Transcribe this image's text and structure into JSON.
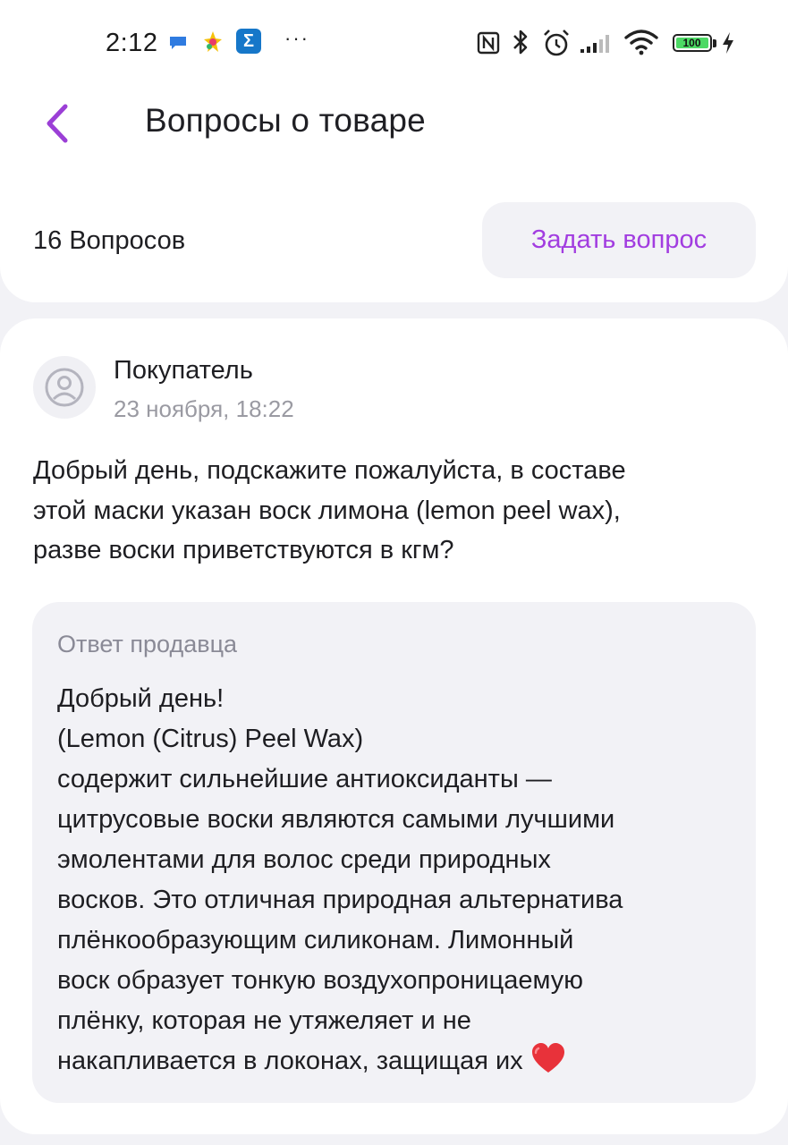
{
  "status_bar": {
    "time": "2:12",
    "more_dots": "···",
    "battery_level": "100",
    "sigma_glyph": "Σ"
  },
  "header": {
    "title": "Вопросы о товаре",
    "back_icon": "chevron-left-icon"
  },
  "questions_summary": {
    "count_label": "16 Вопросов",
    "ask_button_label": "Задать вопрос"
  },
  "question": {
    "author": "Покупатель",
    "date": "23 ноября, 18:22",
    "text": "Добрый день, подскажите пожалуйста, в составе\nэтой маски указан воск лимона (lemon peel wax),\nразве воски приветствуются в кгм?",
    "answer": {
      "label": "Ответ продавца",
      "text": "Добрый день!\n(Lemon (Citrus) Peel Wax)\nсодержит сильнейшие антиоксиданты —\nцитрусовые воски являются самыми лучшими\nэмолентами для волос среди природных\nвосков. Это отличная природная альтернатива\nплёнкообразующим силиконам. Лимонный\nвоск образует тонкую воздухопроницаемую\nплёнку, которая не утяжеляет и не\nнакапливается в локонах, защищая их",
      "emoji": "heart-icon"
    }
  },
  "colors": {
    "accent": "#a23de0",
    "back_chevron": "#9b3fd6",
    "background": "#f2f2f6",
    "card": "#ffffff",
    "muted_text": "#9a9aa2"
  }
}
